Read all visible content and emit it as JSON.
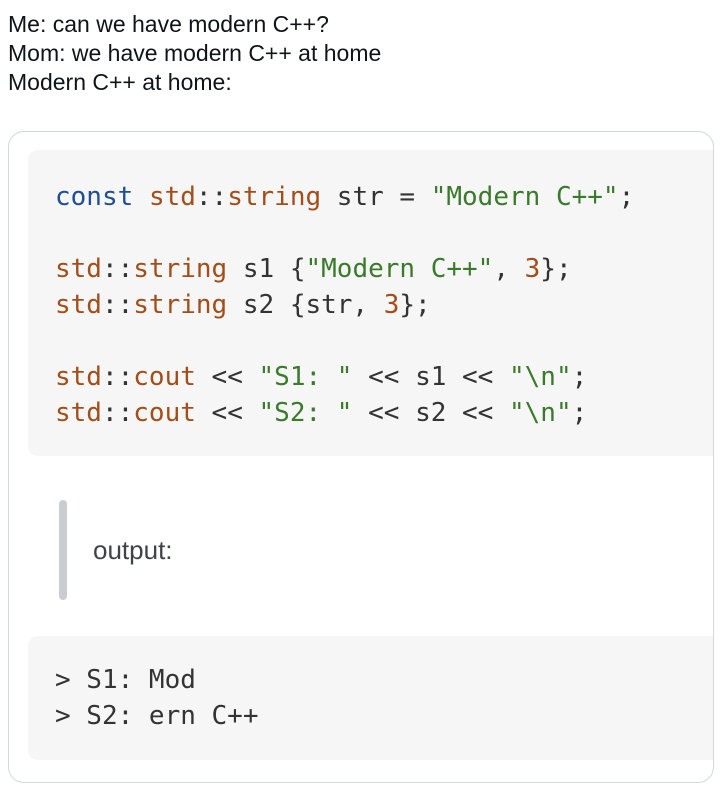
{
  "tweet": {
    "lines": [
      "Me: can we have modern C++?",
      "Mom: we have modern C++ at home",
      "Modern C++ at home:"
    ]
  },
  "colors": {
    "keyword": "#1d4f91",
    "type": "#a34e18",
    "plain": "#333333",
    "string": "#3a7b2b",
    "number": "#a34e18",
    "code_background": "#f6f6f7",
    "quote_bar": "#c9ccd1",
    "card_border": "#cfd9de"
  },
  "code": {
    "lines": [
      [
        {
          "t": "keyword",
          "v": "const"
        },
        {
          "t": "plain",
          "v": " "
        },
        {
          "t": "type",
          "v": "std"
        },
        {
          "t": "plain",
          "v": "::"
        },
        {
          "t": "type",
          "v": "string"
        },
        {
          "t": "plain",
          "v": " str = "
        },
        {
          "t": "string",
          "v": "\"Modern C++\""
        },
        {
          "t": "plain",
          "v": ";"
        }
      ],
      [],
      [
        {
          "t": "type",
          "v": "std"
        },
        {
          "t": "plain",
          "v": "::"
        },
        {
          "t": "type",
          "v": "string"
        },
        {
          "t": "plain",
          "v": " s1 {"
        },
        {
          "t": "string",
          "v": "\"Modern C++\""
        },
        {
          "t": "plain",
          "v": ", "
        },
        {
          "t": "number",
          "v": "3"
        },
        {
          "t": "plain",
          "v": "};"
        }
      ],
      [
        {
          "t": "type",
          "v": "std"
        },
        {
          "t": "plain",
          "v": "::"
        },
        {
          "t": "type",
          "v": "string"
        },
        {
          "t": "plain",
          "v": " s2 {str, "
        },
        {
          "t": "number",
          "v": "3"
        },
        {
          "t": "plain",
          "v": "};"
        }
      ],
      [],
      [
        {
          "t": "type",
          "v": "std"
        },
        {
          "t": "plain",
          "v": "::"
        },
        {
          "t": "type",
          "v": "cout"
        },
        {
          "t": "plain",
          "v": " << "
        },
        {
          "t": "string",
          "v": "\"S1: \""
        },
        {
          "t": "plain",
          "v": " << s1 << "
        },
        {
          "t": "string",
          "v": "\"\\n\""
        },
        {
          "t": "plain",
          "v": ";"
        }
      ],
      [
        {
          "t": "type",
          "v": "std"
        },
        {
          "t": "plain",
          "v": "::"
        },
        {
          "t": "type",
          "v": "cout"
        },
        {
          "t": "plain",
          "v": " << "
        },
        {
          "t": "string",
          "v": "\"S2: \""
        },
        {
          "t": "plain",
          "v": " << s2 << "
        },
        {
          "t": "string",
          "v": "\"\\n\""
        },
        {
          "t": "plain",
          "v": ";"
        }
      ]
    ]
  },
  "quote": {
    "text": "output:"
  },
  "output": {
    "lines": [
      "> S1: Mod",
      "> S2: ern C++"
    ]
  }
}
